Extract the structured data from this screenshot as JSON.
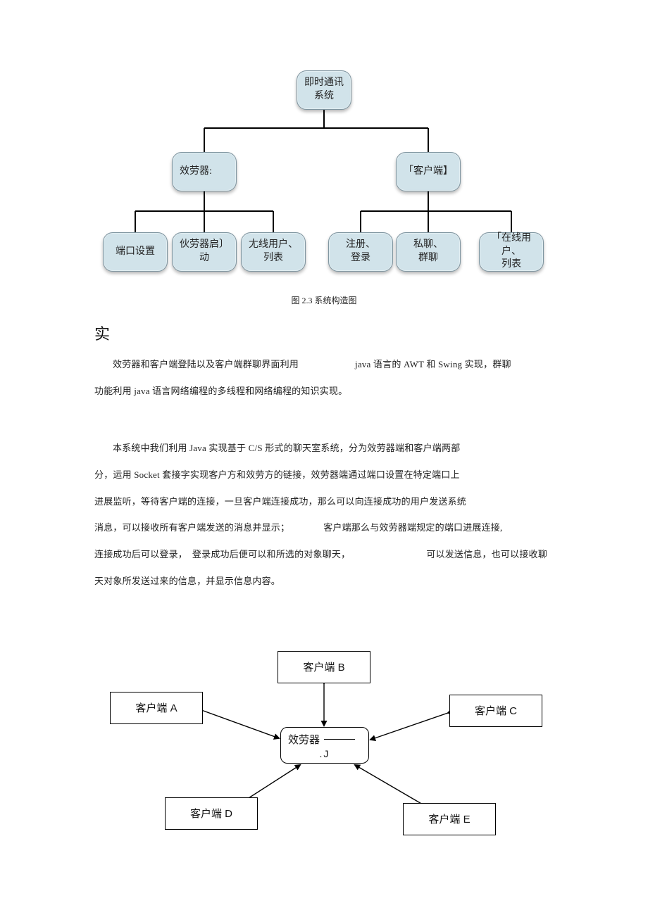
{
  "tree": {
    "root": "即时通讯\n系统",
    "mid_left": "效劳器:",
    "mid_right": "「客户端】",
    "leaves_left": {
      "a": "端口设置",
      "b": "伙劳器启〕\n动",
      "c": "尢线用户、\n列表"
    },
    "leaves_right": {
      "a": "注册、\n登录",
      "b": "私聊、\n群聊",
      "c": "「在线用户、\n列表"
    }
  },
  "caption": "图 2.3 系统构造图",
  "section_heading": "实",
  "para1_a": "效劳器和客户端登陆以及客户端群聊界面利用",
  "para1_b": "java 语言的 AWT 和 Swing 实现，群聊",
  "para1_c": "功能利用 java 语言网络编程的多线程和网络编程的知识实现。",
  "para2_a": "本系统中我们利用 Java 实现基于 C/S 形式的聊天室系统，分为效劳器端和客户端两部",
  "para2_b": "分，运用 Socket 套接字实现客户方和效劳方的链接，效劳器端通过端口设置在特定端口上",
  "para2_c": "进展监听，等待客户端的连接，一旦客户端连接成功，那么可以向连接成功的用户发送系统",
  "para2_d1": "消息，可以接收所有客户端发送的消息并显示；",
  "para2_d2": "客户端那么与效劳器端规定的端口进展连接,",
  "para2_e1": "连接成功后可以登录，",
  "para2_e2": "登录成功后便可以和所选的对象聊天，",
  "para2_e3": "可以发送信息，也可以接收聊",
  "para2_f": "天对象所发送过来的信息，并显示信息内容。",
  "star": {
    "server_label": "效劳器",
    "server_sub": ".J",
    "clients": {
      "a": "客户端 A",
      "b": "客户端 B",
      "c": "客户端 C",
      "d": "客户端 D",
      "e": "客户端 E"
    }
  }
}
